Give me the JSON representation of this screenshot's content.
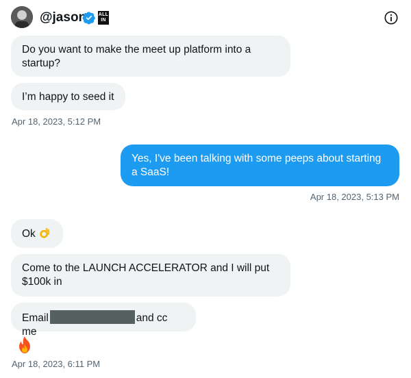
{
  "header": {
    "handle": "@jason",
    "affiliate_badge": "ALL IN",
    "icons": {
      "verified": "verified-badge-icon",
      "info": "info-icon",
      "avatar": "user-avatar"
    }
  },
  "colors": {
    "outgoing_bubble": "#1d9bf0",
    "incoming_bubble": "#eff3f4",
    "timestamp": "#536471",
    "verified": "#1d9bf0"
  },
  "messages": {
    "m1": "Do you want to make the meet up platform into a startup?",
    "m2": "I’m happy to seed it",
    "ts1": "Apr 18, 2023, 5:12 PM",
    "m3": "Yes, I've been talking with some peeps about starting a SaaS!",
    "ts2": "Apr 18, 2023, 5:13 PM",
    "m4_text": "Ok",
    "m4_emoji": "ok-hand-emoji",
    "m5": "Come to the LAUNCH ACCELERATOR and I will put $100k in",
    "m6_before": "Email",
    "m6_after": "and cc me",
    "m7_emoji": "fire-emoji",
    "ts3": "Apr 18, 2023, 6:11 PM"
  }
}
